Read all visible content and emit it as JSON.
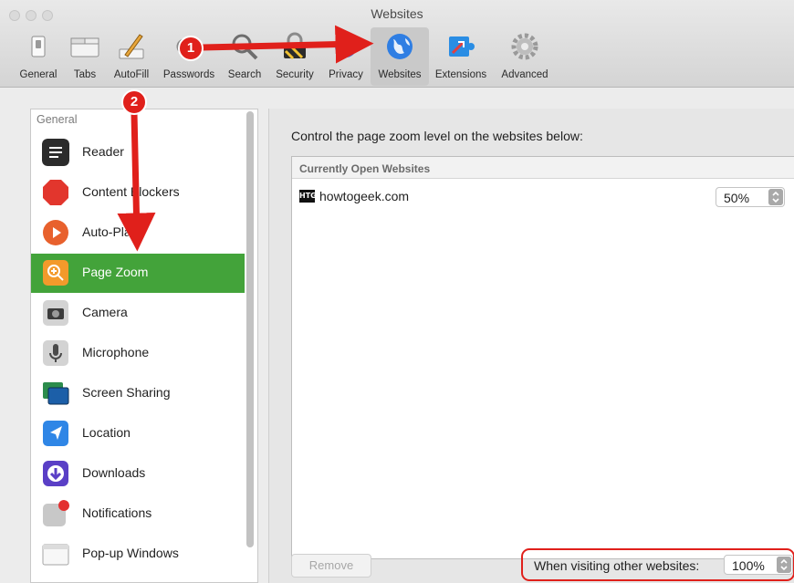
{
  "window": {
    "title": "Websites"
  },
  "toolbar": {
    "items": [
      {
        "label": "General",
        "icon": "toggle-switch-icon"
      },
      {
        "label": "Tabs",
        "icon": "tabs-icon"
      },
      {
        "label": "AutoFill",
        "icon": "pencil-form-icon"
      },
      {
        "label": "Passwords",
        "icon": "key-icon"
      },
      {
        "label": "Search",
        "icon": "magnifier-icon"
      },
      {
        "label": "Security",
        "icon": "lock-shield-icon"
      },
      {
        "label": "Privacy",
        "icon": "hand-icon"
      },
      {
        "label": "Websites",
        "icon": "globe-icon",
        "active": true
      },
      {
        "label": "Extensions",
        "icon": "puzzle-icon"
      },
      {
        "label": "Advanced",
        "icon": "gear-icon"
      }
    ]
  },
  "sidebar": {
    "header": "General",
    "items": [
      {
        "label": "Reader",
        "icon": "reader-icon"
      },
      {
        "label": "Content Blockers",
        "icon": "stop-octagon-icon"
      },
      {
        "label": "Auto-Play",
        "icon": "play-icon"
      },
      {
        "label": "Page Zoom",
        "icon": "zoom-icon",
        "selected": true
      },
      {
        "label": "Camera",
        "icon": "camera-icon"
      },
      {
        "label": "Microphone",
        "icon": "microphone-icon"
      },
      {
        "label": "Screen Sharing",
        "icon": "screen-sharing-icon"
      },
      {
        "label": "Location",
        "icon": "location-arrow-icon"
      },
      {
        "label": "Downloads",
        "icon": "download-icon"
      },
      {
        "label": "Notifications",
        "icon": "notifications-icon"
      },
      {
        "label": "Pop-up Windows",
        "icon": "popup-window-icon"
      }
    ]
  },
  "main": {
    "instruction": "Control the page zoom level on the websites below:",
    "table_header": "Currently Open Websites",
    "sites": [
      {
        "favicon_text": "HTG",
        "name": "howtogeek.com",
        "zoom": "50%"
      }
    ],
    "remove_label": "Remove",
    "other_label": "When visiting other websites:",
    "other_value": "100%"
  },
  "annotations": {
    "step1": "1",
    "step2": "2"
  },
  "colors": {
    "selection": "#43a33a",
    "annotation": "#e0201b"
  }
}
